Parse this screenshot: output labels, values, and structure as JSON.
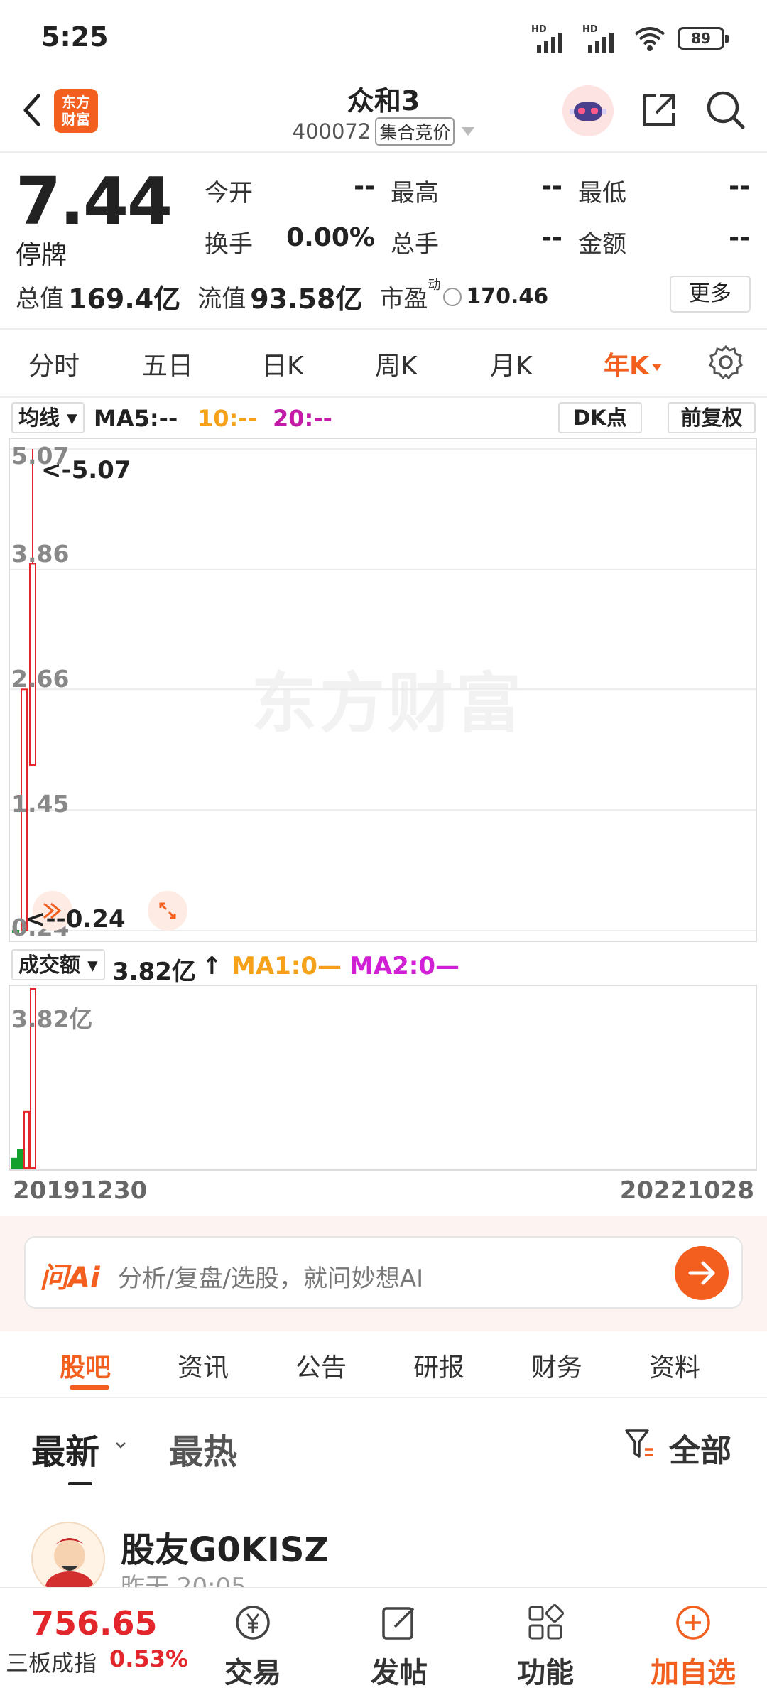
{
  "status": {
    "time": "5:25",
    "signal1": "HD",
    "signal2": "HD",
    "battery": "89"
  },
  "header": {
    "title": "众和3",
    "code": "400072",
    "auction_tag": "集合竞价",
    "logo_line1": "东方",
    "logo_line2": "财富",
    "icons": [
      "back-icon",
      "robot-icon",
      "share-icon",
      "search-icon"
    ]
  },
  "quote": {
    "price": "7.44",
    "status": "停牌",
    "open_label": "今开",
    "open_value": "--",
    "high_label": "最高",
    "high_value": "--",
    "low_label": "最低",
    "low_value": "--",
    "turnover_label": "换手",
    "turnover_value": "0.00%",
    "volume_label": "总手",
    "volume_value": "--",
    "amount_label": "金额",
    "amount_value": "--",
    "mcap_label": "总值",
    "mcap_value": "169.4亿",
    "float_label": "流值",
    "float_value": "93.58亿",
    "pe_label": "市盈",
    "pe_sup": "动",
    "pe_value": "170.46",
    "more_label": "更多"
  },
  "period_tabs": [
    "分时",
    "五日",
    "日K",
    "周K",
    "月K",
    "年K"
  ],
  "active_period": "年K",
  "indicators": {
    "ma_select": "均线",
    "ma5": "MA5:--",
    "ma10": "10:--",
    "ma20": "20:--",
    "dk": "DK点",
    "adjust": "前复权",
    "vol_select": "成交额",
    "vol_value": "3.82亿",
    "vol_arrow": "↑",
    "ma1": "MA1:0—",
    "ma2": "MA2:0—"
  },
  "colors": {
    "accent": "#f25f1e",
    "up": "#e3262b",
    "down": "#14a02c",
    "ma10": "#f5a11a",
    "ma20": "#c41aa7",
    "ma1": "#f5a11a",
    "ma2": "#d11fd6"
  },
  "chart_data": {
    "type": "candlestick",
    "watermark": "东方财富",
    "y_ticks": [
      "5.07",
      "3.86",
      "2.66",
      "1.45",
      "0.24"
    ],
    "ylim": [
      0.24,
      5.07
    ],
    "max_annotation": "<-5.07",
    "min_annotation": "<--0.24",
    "x_start": "20191230",
    "x_end": "20221028",
    "candles": [
      {
        "date": "2019",
        "open": 0.24,
        "close": 0.24,
        "high": 0.3,
        "low": 0.2,
        "dir": "down"
      },
      {
        "date": "2020",
        "open": 0.24,
        "close": 2.66,
        "high": 2.66,
        "low": 0.24,
        "dir": "up"
      },
      {
        "date": "2021",
        "open": 1.9,
        "close": 3.92,
        "high": 5.07,
        "low": 1.9,
        "dir": "up"
      }
    ],
    "volume": {
      "label": "3.82亿",
      "max": 3.82,
      "bars": [
        {
          "value": 0.2,
          "dir": "down"
        },
        {
          "value": 0.38,
          "dir": "down"
        },
        {
          "value": 1.2,
          "dir": "up"
        },
        {
          "value": 3.82,
          "dir": "up"
        }
      ]
    }
  },
  "ai": {
    "logo": "问Ai",
    "placeholder": "分析/复盘/选股，就问妙想AI"
  },
  "section_tabs": [
    "股吧",
    "资讯",
    "公告",
    "研报",
    "财务",
    "资料"
  ],
  "sort": {
    "newest": "最新",
    "hottest": "最热",
    "filter": "全部"
  },
  "post": {
    "user": "股友G0KISZ",
    "time": "昨天 20:05"
  },
  "bottom_bar": {
    "index_value": "756.65",
    "index_name": "三板成指",
    "index_pct": "0.53%",
    "trade": "交易",
    "post": "发帖",
    "functions": "功能",
    "add_watch": "加自选"
  }
}
